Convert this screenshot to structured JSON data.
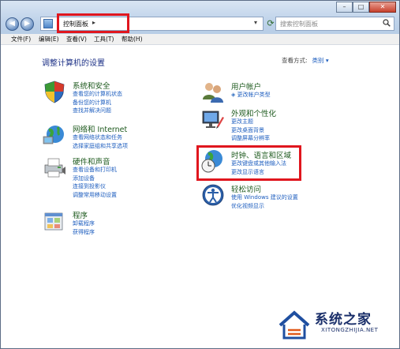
{
  "address": {
    "breadcrumb": "控制面板",
    "separator": "▸"
  },
  "search": {
    "placeholder": "搜索控制面板"
  },
  "menu": [
    "文件(F)",
    "编辑(E)",
    "查看(V)",
    "工具(T)",
    "帮助(H)"
  ],
  "content": {
    "heading": "调整计算机的设置",
    "view_by_label": "查看方式:",
    "view_by_value": "类别 ▾"
  },
  "categories": [
    {
      "title": "系统和安全",
      "links": [
        "查看您的计算机状态",
        "备份您的计算机",
        "查找并解决问题"
      ],
      "icon": "shield-icon"
    },
    {
      "title": "网络和 Internet",
      "links": [
        "查看网络状态和任务",
        "选择家庭组和共享选项"
      ],
      "icon": "network-icon"
    },
    {
      "title": "硬件和声音",
      "links": [
        "查看设备和打印机",
        "添加设备",
        "连接到投影仪",
        "调整常用移动设置"
      ],
      "icon": "printer-icon"
    },
    {
      "title": "程序",
      "links": [
        "卸载程序",
        "获得程序"
      ],
      "icon": "programs-icon"
    },
    {
      "title": "用户帐户",
      "links": [
        "更改帐户类型"
      ],
      "icon": "users-icon"
    },
    {
      "title": "外观和个性化",
      "links": [
        "更改主题",
        "更改桌面背景",
        "调整屏幕分辨率"
      ],
      "icon": "display-icon"
    },
    {
      "title": "时钟、语言和区域",
      "links": [
        "更改键盘或其他输入法",
        "更改显示语言"
      ],
      "icon": "clock-globe-icon"
    },
    {
      "title": "轻松访问",
      "links": [
        "使用 Windows 建议的设置",
        "优化视频显示"
      ],
      "icon": "accessibility-icon"
    }
  ],
  "watermark": {
    "title": "系统之家",
    "subtitle": "XITONGZHIJIA.NET"
  },
  "colors": {
    "highlight": "#e0161e",
    "link": "#1e5ebf",
    "category_title": "#1e5a1e",
    "heading": "#1e3287"
  }
}
